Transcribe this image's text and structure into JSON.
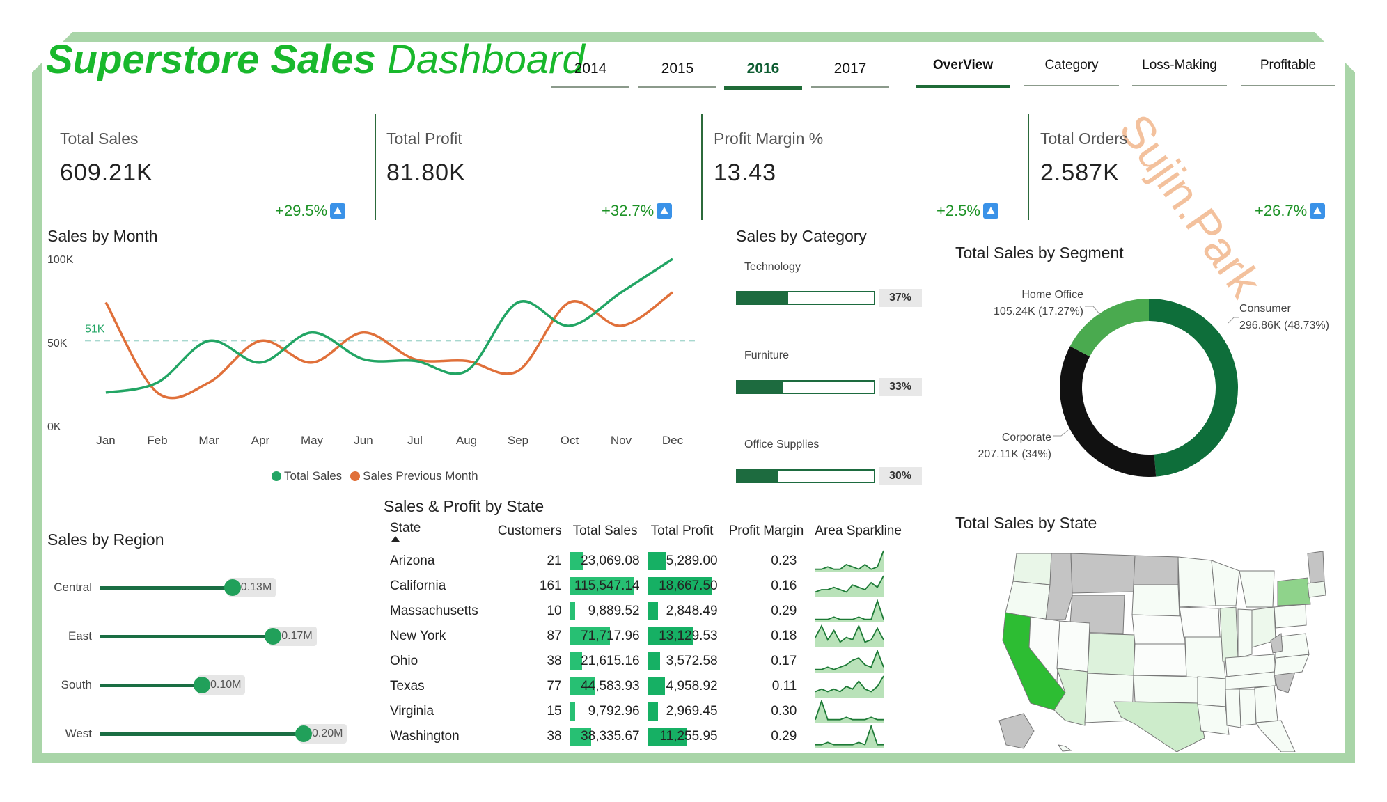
{
  "header": {
    "title_bold": "Superstore Sales",
    "title_thin": "Dashboard",
    "watermark": "Sujin.Park"
  },
  "year_tabs": [
    {
      "label": "2014",
      "active": false
    },
    {
      "label": "2015",
      "active": false
    },
    {
      "label": "2016",
      "active": true
    },
    {
      "label": "2017",
      "active": false
    }
  ],
  "page_tabs": [
    {
      "label": "OverView",
      "active": true
    },
    {
      "label": "Category",
      "active": false
    },
    {
      "label": "Loss-Making",
      "active": false
    },
    {
      "label": "Profitable",
      "active": false
    }
  ],
  "kpis": [
    {
      "label": "Total Sales",
      "value": "609.21K",
      "delta": "+29.5%"
    },
    {
      "label": "Total Profit",
      "value": "81.80K",
      "delta": "+32.7%"
    },
    {
      "label": "Profit Margin %",
      "value": "13.43",
      "delta": "+2.5%"
    },
    {
      "label": "Total Orders",
      "value": "2.587K",
      "delta": "+26.7%"
    }
  ],
  "sales_by_month": {
    "title": "Sales by Month",
    "y_ticks": [
      "100K",
      "50K",
      "0K"
    ],
    "avg_label": "51K",
    "legend": [
      "Total Sales",
      "Sales Previous Month"
    ],
    "colors": {
      "total": "#22a564",
      "previous": "#e0703a"
    }
  },
  "sales_by_category": {
    "title": "Sales by Category",
    "items": [
      {
        "label": "Technology",
        "pct_text": "37%",
        "fill": 0.37
      },
      {
        "label": "Furniture",
        "pct_text": "33%",
        "fill": 0.33
      },
      {
        "label": "Office Supplies",
        "pct_text": "30%",
        "fill": 0.3
      }
    ]
  },
  "sales_by_segment": {
    "title": "Total Sales by Segment",
    "labels": {
      "home_office": [
        "Home Office",
        "105.24K (17.27%)"
      ],
      "consumer": [
        "Consumer",
        "296.86K (48.73%)"
      ],
      "corporate": [
        "Corporate",
        "207.11K (34%)"
      ]
    }
  },
  "sales_by_region": {
    "title": "Sales by Region",
    "items": [
      {
        "label": "Central",
        "value_text": "0.13M",
        "value": 0.13
      },
      {
        "label": "East",
        "value_text": "0.17M",
        "value": 0.17
      },
      {
        "label": "South",
        "value_text": "0.10M",
        "value": 0.1
      },
      {
        "label": "West",
        "value_text": "0.20M",
        "value": 0.2
      }
    ]
  },
  "state_table": {
    "title": "Sales & Profit by State",
    "columns": [
      "State",
      "Customers",
      "Total Sales",
      "Total Profit",
      "Profit Margin",
      "Area Sparkline"
    ],
    "rows": [
      {
        "state": "Arizona",
        "customers": "21",
        "sales": "23,069.08",
        "profit": "5,289.00",
        "margin": "0.23",
        "sales_v": 23069.08,
        "profit_v": 5289.0,
        "spark": [
          1,
          1,
          2,
          1,
          1,
          3,
          2,
          1,
          3,
          1,
          2,
          9
        ]
      },
      {
        "state": "California",
        "customers": "161",
        "sales": "115,547.14",
        "profit": "18,667.50",
        "margin": "0.16",
        "sales_v": 115547.14,
        "profit_v": 18667.5,
        "spark": [
          2,
          3,
          3,
          4,
          3,
          2,
          5,
          4,
          3,
          6,
          4,
          9
        ]
      },
      {
        "state": "Massachusetts",
        "customers": "10",
        "sales": "9,889.52",
        "profit": "2,848.49",
        "margin": "0.29",
        "sales_v": 9889.52,
        "profit_v": 2848.49,
        "spark": [
          1,
          1,
          1,
          2,
          1,
          1,
          1,
          2,
          1,
          1,
          9,
          1
        ]
      },
      {
        "state": "New York",
        "customers": "87",
        "sales": "71,717.96",
        "profit": "13,129.53",
        "margin": "0.18",
        "sales_v": 71717.96,
        "profit_v": 13129.53,
        "spark": [
          4,
          9,
          3,
          7,
          2,
          4,
          3,
          9,
          2,
          3,
          8,
          3
        ]
      },
      {
        "state": "Ohio",
        "customers": "38",
        "sales": "21,615.16",
        "profit": "3,572.58",
        "margin": "0.17",
        "sales_v": 21615.16,
        "profit_v": 3572.58,
        "spark": [
          1,
          1,
          2,
          1,
          2,
          3,
          5,
          6,
          3,
          2,
          9,
          2
        ]
      },
      {
        "state": "Texas",
        "customers": "77",
        "sales": "44,583.93",
        "profit": "4,958.92",
        "margin": "0.11",
        "sales_v": 44583.93,
        "profit_v": 4958.92,
        "spark": [
          2,
          3,
          2,
          3,
          2,
          4,
          3,
          6,
          3,
          2,
          4,
          8
        ]
      },
      {
        "state": "Virginia",
        "customers": "15",
        "sales": "9,792.96",
        "profit": "2,969.45",
        "margin": "0.30",
        "sales_v": 9792.96,
        "profit_v": 2969.45,
        "spark": [
          1,
          9,
          1,
          1,
          1,
          2,
          1,
          1,
          1,
          2,
          1,
          1
        ]
      },
      {
        "state": "Washington",
        "customers": "38",
        "sales": "38,335.67",
        "profit": "11,255.95",
        "margin": "0.29",
        "sales_v": 38335.67,
        "profit_v": 11255.95,
        "spark": [
          1,
          1,
          2,
          1,
          1,
          1,
          1,
          2,
          1,
          9,
          1,
          1
        ]
      }
    ]
  },
  "sales_by_state_map": {
    "title": "Total Sales by State"
  },
  "chart_data": [
    {
      "type": "line",
      "title": "Sales by Month",
      "categories": [
        "Jan",
        "Feb",
        "Mar",
        "Apr",
        "May",
        "Jun",
        "Jul",
        "Aug",
        "Sep",
        "Oct",
        "Nov",
        "Dec"
      ],
      "series": [
        {
          "name": "Total Sales",
          "values": [
            20,
            26,
            51,
            38,
            56,
            40,
            39,
            33,
            74,
            60,
            80,
            100
          ]
        },
        {
          "name": "Sales Previous Month",
          "values": [
            74,
            20,
            26,
            51,
            38,
            56,
            40,
            39,
            33,
            74,
            60,
            80
          ]
        }
      ],
      "ylim": [
        0,
        100
      ],
      "y_unit": "K",
      "reference_line": 51
    },
    {
      "type": "bar",
      "title": "Sales by Category",
      "categories": [
        "Technology",
        "Furniture",
        "Office Supplies"
      ],
      "values": [
        37,
        33,
        30
      ]
    },
    {
      "type": "pie",
      "title": "Total Sales by Segment",
      "categories": [
        "Consumer",
        "Corporate",
        "Home Office"
      ],
      "values": [
        296.86,
        207.11,
        105.24
      ],
      "colors": [
        "#0e6e3a",
        "#111111",
        "#4aaa4f"
      ]
    },
    {
      "type": "bar",
      "title": "Sales by Region",
      "categories": [
        "Central",
        "East",
        "South",
        "West"
      ],
      "values": [
        0.13,
        0.17,
        0.1,
        0.2
      ]
    }
  ]
}
